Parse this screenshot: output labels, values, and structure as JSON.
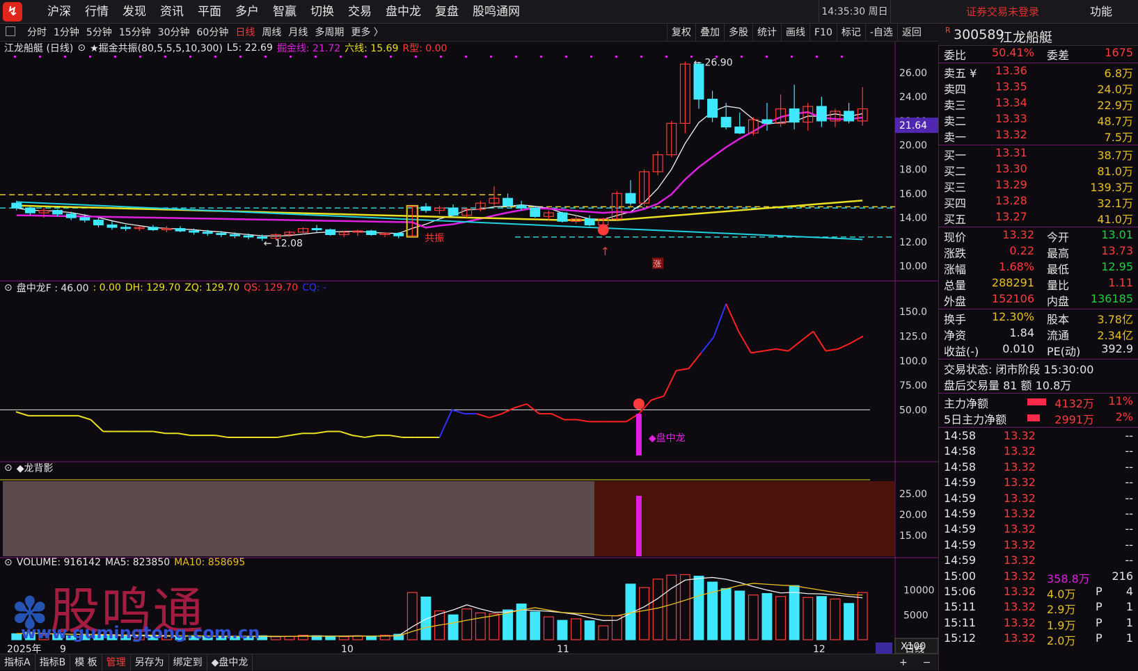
{
  "app": {
    "logo_text": "↯",
    "menu": [
      "沪深",
      "行情",
      "发现",
      "资讯",
      "平面",
      "多户",
      "智赢",
      "切换",
      "交易",
      "盘中龙",
      "复盘",
      "股鸣通网"
    ],
    "clock": "14:35:30 周日",
    "login_status": "证券交易未登录",
    "func_label": "功能"
  },
  "periods": [
    "分时",
    "1分钟",
    "5分钟",
    "15分钟",
    "30分钟",
    "60分钟",
    "日线",
    "周线",
    "月线",
    "多周期",
    "更多 〉"
  ],
  "active_period": "日线",
  "tools": [
    "复权",
    "叠加",
    "多股",
    "统计",
    "画线",
    "F10",
    "标记",
    "-自选",
    "返回"
  ],
  "main_chart": {
    "title": "江龙船艇 (日线)",
    "indicator": "★掘金共振(80,5,5,5,10,300)",
    "l5": "L5: 22.69",
    "jjx": "掘金线: 21.72",
    "lx": "六线: 15.69",
    "rx": "R型: 0.00",
    "y_ticks": [
      "26.00",
      "24.00",
      "22.00",
      "20.00",
      "18.00",
      "16.00",
      "14.00",
      "12.00",
      "10.00"
    ],
    "price_badge": "21.64",
    "high_label": "26.90",
    "low_label": "12.08",
    "resonance_label": "共振",
    "zhang_label": "涨",
    "candles": [
      [
        15.2,
        15.4,
        14.6,
        14.8
      ],
      [
        14.8,
        15.0,
        14.2,
        14.4
      ],
      [
        14.4,
        14.8,
        14.0,
        14.6
      ],
      [
        14.6,
        14.7,
        14.1,
        14.3
      ],
      [
        14.3,
        14.5,
        13.8,
        14.0
      ],
      [
        14.0,
        14.3,
        13.6,
        13.8
      ],
      [
        13.8,
        14.0,
        13.2,
        13.4
      ],
      [
        13.4,
        13.7,
        13.0,
        13.2
      ],
      [
        13.2,
        13.4,
        12.9,
        13.1
      ],
      [
        13.1,
        13.3,
        12.9,
        13.2
      ],
      [
        13.2,
        13.4,
        12.9,
        13.0
      ],
      [
        13.0,
        13.3,
        12.8,
        13.1
      ],
      [
        13.1,
        13.3,
        12.8,
        12.9
      ],
      [
        12.9,
        13.1,
        12.6,
        12.8
      ],
      [
        12.8,
        13.0,
        12.5,
        12.7
      ],
      [
        12.7,
        12.9,
        12.4,
        12.6
      ],
      [
        12.6,
        12.8,
        12.3,
        12.5
      ],
      [
        12.5,
        12.7,
        12.2,
        12.4
      ],
      [
        12.4,
        12.6,
        12.08,
        12.3
      ],
      [
        12.3,
        12.7,
        12.2,
        12.6
      ],
      [
        12.6,
        12.9,
        12.4,
        12.8
      ],
      [
        12.8,
        13.2,
        12.6,
        13.1
      ],
      [
        13.1,
        13.4,
        12.8,
        13.0
      ],
      [
        13.0,
        13.1,
        12.5,
        12.6
      ],
      [
        12.6,
        12.9,
        12.4,
        12.8
      ],
      [
        12.8,
        13.0,
        12.5,
        12.9
      ],
      [
        12.9,
        13.0,
        12.5,
        12.6
      ],
      [
        12.6,
        12.8,
        12.4,
        12.7
      ],
      [
        12.7,
        12.8,
        12.3,
        12.5
      ],
      [
        12.5,
        15.0,
        12.4,
        14.9
      ],
      [
        14.9,
        15.2,
        14.4,
        14.6
      ],
      [
        14.6,
        15.0,
        14.3,
        14.8
      ],
      [
        14.8,
        15.1,
        14.0,
        14.2
      ],
      [
        14.2,
        14.8,
        14.0,
        14.7
      ],
      [
        14.7,
        15.4,
        14.5,
        15.2
      ],
      [
        15.2,
        16.6,
        15.0,
        15.6
      ],
      [
        15.6,
        16.0,
        14.9,
        15.0
      ],
      [
        15.0,
        15.4,
        14.6,
        14.8
      ],
      [
        14.8,
        14.9,
        14.0,
        14.1
      ],
      [
        14.1,
        14.6,
        13.8,
        14.4
      ],
      [
        14.4,
        14.5,
        13.6,
        13.7
      ],
      [
        13.7,
        14.2,
        13.5,
        13.9
      ],
      [
        13.9,
        14.2,
        13.3,
        13.4
      ],
      [
        13.4,
        14.0,
        13.2,
        13.9
      ],
      [
        13.9,
        16.2,
        13.8,
        16.0
      ],
      [
        16.0,
        17.1,
        15.0,
        15.2
      ],
      [
        15.2,
        18.0,
        15.0,
        17.8
      ],
      [
        17.8,
        19.5,
        17.5,
        19.2
      ],
      [
        19.2,
        22.0,
        19.0,
        21.8
      ],
      [
        21.8,
        26.9,
        21.0,
        26.7
      ],
      [
        26.7,
        26.9,
        23.0,
        23.8
      ],
      [
        23.8,
        24.5,
        21.9,
        22.3
      ],
      [
        22.3,
        23.5,
        21.3,
        21.5
      ],
      [
        21.5,
        22.7,
        20.9,
        21.0
      ],
      [
        21.0,
        22.3,
        20.8,
        22.1
      ],
      [
        22.1,
        23.5,
        21.2,
        21.8
      ],
      [
        21.8,
        24.2,
        21.5,
        23.0
      ],
      [
        23.0,
        25.0,
        21.3,
        21.9
      ],
      [
        21.9,
        23.5,
        21.2,
        23.2
      ],
      [
        23.2,
        24.0,
        21.5,
        22.0
      ],
      [
        22.0,
        23.0,
        21.5,
        22.8
      ],
      [
        22.8,
        23.5,
        21.8,
        22.0
      ],
      [
        22.0,
        24.8,
        21.6,
        23.0
      ]
    ]
  },
  "dragon_chart": {
    "title": "盘中龙F : 46.00",
    "v0": ": 0.00",
    "dh": "DH: 129.70",
    "zq": "ZQ: 129.70",
    "qs": "QS: 129.70",
    "cq": "CQ: -",
    "y_ticks": [
      "150.0",
      "125.0",
      "100.0",
      "75.00",
      "50.00"
    ],
    "signal_label": "◆盘中龙",
    "line": [
      48,
      44,
      44,
      44,
      44,
      44,
      40,
      28,
      28,
      28,
      28,
      28,
      26,
      26,
      24,
      24,
      24,
      22,
      22,
      22,
      22,
      22,
      24,
      26,
      26,
      28,
      28,
      24,
      22,
      24,
      24,
      22,
      22,
      22,
      22,
      50,
      46,
      46,
      42,
      46,
      52,
      56,
      46,
      46,
      40,
      40,
      38,
      38,
      38,
      38,
      46,
      60,
      64,
      90,
      92,
      108,
      124,
      158,
      130,
      108,
      110,
      112,
      110,
      120,
      130,
      110,
      112,
      118,
      125
    ]
  },
  "bg_chart": {
    "title": "◆龙背影",
    "y_ticks": [
      "25.00",
      "20.00",
      "15.00"
    ]
  },
  "volume_chart": {
    "title": "VOLUME: 916142",
    "ma5": "MA5: 823850",
    "ma10": "MA10: 858695",
    "y_ticks": [
      "10000",
      "5000"
    ],
    "unit": "X100",
    "watermark": "股鸣通",
    "watermark_url": "www.gumingtong.com.cn",
    "dates": [
      "2025年",
      "9",
      "10",
      "11",
      "12"
    ],
    "period_label": "日线",
    "bars": [
      1200,
      1500,
      900,
      1100,
      800,
      1000,
      900,
      700,
      600,
      800,
      900,
      700,
      600,
      800,
      700,
      600,
      500,
      700,
      800,
      600,
      700,
      900,
      800,
      700,
      600,
      800,
      700,
      900,
      1100,
      9500,
      8600,
      5800,
      5000,
      6200,
      5400,
      5200,
      6000,
      7200,
      5600,
      4600,
      3900,
      4200,
      3800,
      2800,
      4800,
      11200,
      10500,
      12200,
      13000,
      13100,
      12800,
      11600,
      10300,
      9800,
      9000,
      9300,
      8700,
      10900,
      8500,
      8700,
      8200,
      7300,
      9500
    ]
  },
  "bottom_tabs": [
    "指标A",
    "指标B",
    "模 板",
    "管理",
    "另存为",
    "绑定到",
    "◆盘中龙"
  ],
  "bottom_right": [
    "+",
    "−"
  ],
  "quote": {
    "code": "300589",
    "name": "江龙船艇",
    "weibi_label": "委比",
    "weibi": "50.41%",
    "weicha_label": "委差",
    "weicha": "1675",
    "sells": [
      {
        "label": "卖五 ¥",
        "price": "13.36",
        "vol": "6.8万"
      },
      {
        "label": "卖四",
        "price": "13.35",
        "vol": "24.0万"
      },
      {
        "label": "卖三",
        "price": "13.34",
        "vol": "22.9万"
      },
      {
        "label": "卖二",
        "price": "13.33",
        "vol": "48.7万"
      },
      {
        "label": "卖一",
        "price": "13.32",
        "vol": "7.5万"
      }
    ],
    "buys": [
      {
        "label": "买一",
        "price": "13.31",
        "vol": "38.7万"
      },
      {
        "label": "买二",
        "price": "13.30",
        "vol": "81.0万"
      },
      {
        "label": "买三",
        "price": "13.29",
        "vol": "139.3万"
      },
      {
        "label": "买四",
        "price": "13.28",
        "vol": "32.1万"
      },
      {
        "label": "买五",
        "price": "13.27",
        "vol": "41.0万"
      }
    ],
    "stats": [
      [
        "现价",
        "13.32",
        "今开",
        "13.01"
      ],
      [
        "涨跌",
        "0.22",
        "最高",
        "13.73"
      ],
      [
        "涨幅",
        "1.68%",
        "最低",
        "12.95"
      ],
      [
        "总量",
        "288291",
        "量比",
        "1.11"
      ],
      [
        "外盘",
        "152106",
        "内盘",
        "136185"
      ],
      [
        "换手",
        "12.30%",
        "股本",
        "3.78亿"
      ],
      [
        "净资",
        "1.84",
        "流通",
        "2.34亿"
      ],
      [
        "收益(-)",
        "0.010",
        "PE(动)",
        "392.9"
      ]
    ],
    "trade_status": "交易状态: 闭市阶段 15:30:00",
    "after_hours": "盘后交易量 81 额 10.8万",
    "main_net_label": "主力净额",
    "main_net": "4132万",
    "main_net_pct": "11%",
    "five_net_label": "5日主力净额",
    "five_net": "2991万",
    "five_net_pct": "2%",
    "ticks": [
      [
        "14:58",
        "13.32",
        "",
        "",
        "--"
      ],
      [
        "14:58",
        "13.32",
        "",
        "",
        "--"
      ],
      [
        "14:58",
        "13.32",
        "",
        "",
        "--"
      ],
      [
        "14:59",
        "13.32",
        "",
        "",
        "--"
      ],
      [
        "14:59",
        "13.32",
        "",
        "",
        "--"
      ],
      [
        "14:59",
        "13.32",
        "",
        "",
        "--"
      ],
      [
        "14:59",
        "13.32",
        "",
        "",
        "--"
      ],
      [
        "14:59",
        "13.32",
        "",
        "",
        "--"
      ],
      [
        "14:59",
        "13.32",
        "",
        "",
        "--"
      ],
      [
        "15:00",
        "13.32",
        "358.8万",
        "",
        "216"
      ],
      [
        "15:06",
        "13.32",
        "4.0万",
        "P",
        "4"
      ],
      [
        "15:11",
        "13.32",
        "2.9万",
        "P",
        "1"
      ],
      [
        "15:11",
        "13.32",
        "1.9万",
        "P",
        "1"
      ],
      [
        "15:12",
        "13.32",
        "2.0万",
        "P",
        "1"
      ]
    ]
  },
  "colors": {
    "up": "#ff3c3c",
    "down": "#40e8ff",
    "ma_white": "#f0f0f0",
    "ma_magenta": "#e020e0",
    "ma_yellow": "#e8e020",
    "ma_cyan": "#20d0e0",
    "bg_gray": "#5a4a4c",
    "bg_red": "#4a1208"
  }
}
